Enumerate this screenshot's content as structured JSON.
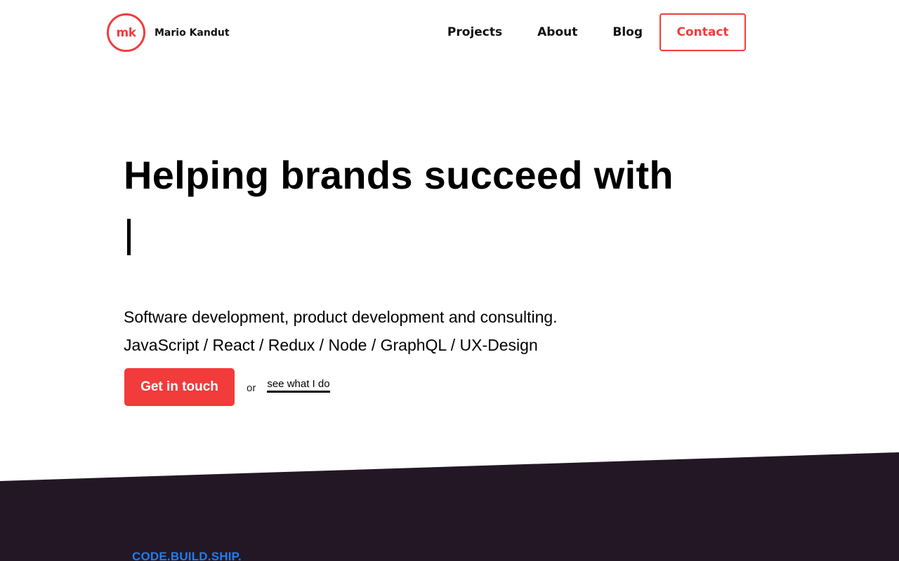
{
  "header": {
    "logo_mark": "mk",
    "logo_name": "Mario Kandut",
    "nav": [
      {
        "label": "Projects"
      },
      {
        "label": "About"
      },
      {
        "label": "Blog"
      }
    ],
    "contact_label": "Contact"
  },
  "hero": {
    "title": "Helping brands succeed with",
    "subtitle_line1": "Software development, product development and consulting.",
    "subtitle_line2": "JavaScript / React / Redux / Node / GraphQL / UX-Design",
    "cta_label": "Get in touch",
    "or_label": "or",
    "secondary_link": "see what I do"
  },
  "section": {
    "tagline": "CODE.BUILD.SHIP."
  },
  "colors": {
    "accent": "#f23b3b",
    "dark_bg": "#231725",
    "tagline": "#1d7ef0"
  }
}
